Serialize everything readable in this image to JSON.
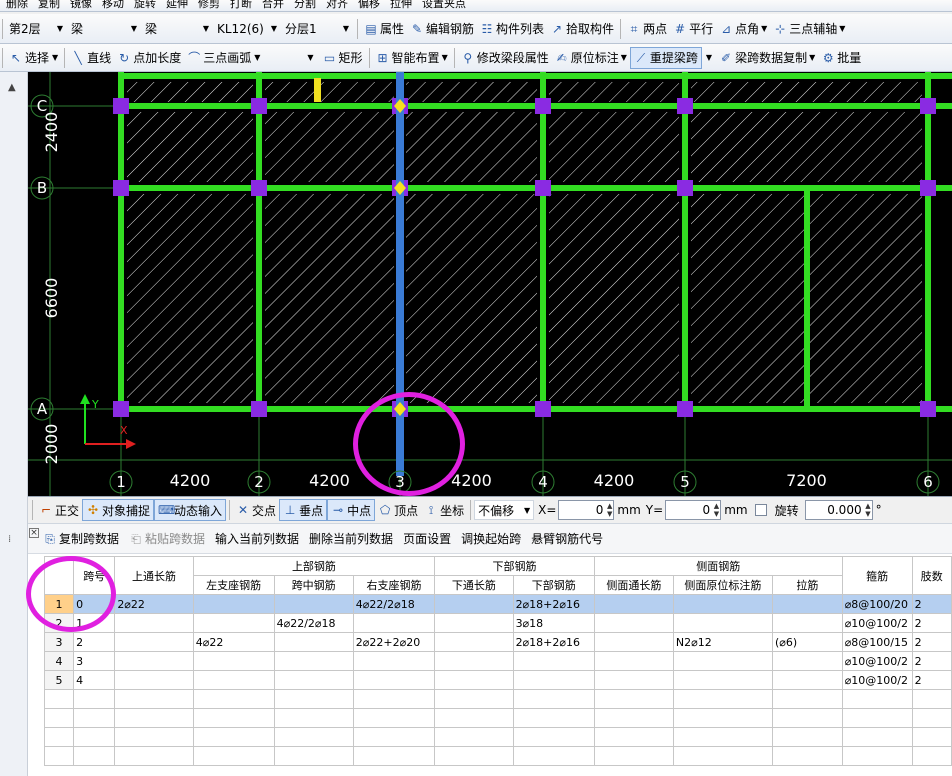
{
  "toolbar0": {
    "items": [
      "删除",
      "复制",
      "镜像",
      "移动",
      "旋转",
      "延伸",
      "修剪",
      "打断",
      "合并",
      "分割",
      "对齐",
      "偏移",
      "拉伸",
      "设置夹点"
    ]
  },
  "toolbar1": {
    "floor": "第2层",
    "type_a": "梁",
    "type_b": "梁",
    "component": "KL12(6)",
    "layer": "分层1",
    "properties": "属性",
    "edit_rebar": "编辑钢筋",
    "component_list": "构件列表",
    "pick_component": "拾取构件",
    "two_points": "两点",
    "parallel": "平行",
    "point_angle": "点角",
    "three_point_axis": "三点辅轴"
  },
  "toolbar2": {
    "select": "选择",
    "line": "直线",
    "point_length": "点加长度",
    "three_point_arc": "三点画弧",
    "rectangle": "矩形",
    "smart_layout": "智能布置",
    "modify_span_props": "修改梁段属性",
    "original_annotation": "原位标注",
    "reextract_span": "重提梁跨",
    "span_data_copy": "梁跨数据复制",
    "batch": "批量"
  },
  "canvas": {
    "colors": {
      "background": "#000000",
      "beam": "#33dd22",
      "selected_beam": "#3a7bd5",
      "column": "#8a2be2",
      "grid": "#2e7d32",
      "hatch": "#e8e8e8",
      "axis_text": "#ffffff"
    },
    "row_axes": [
      {
        "label": "C",
        "dim": "2400"
      },
      {
        "label": "B",
        "dim": "6600"
      },
      {
        "label": "A",
        "dim": "2000"
      }
    ],
    "column_axes": [
      "1",
      "2",
      "3",
      "4",
      "5",
      "6"
    ],
    "spans": [
      "4200",
      "4200",
      "4200",
      "4200",
      "7200"
    ],
    "ucs": {
      "x": "X",
      "y": "Y"
    }
  },
  "statusbar": {
    "ortho": "正交",
    "object_snap": "对象捕捉",
    "dynamic_input": "动态输入",
    "intersection": "交点",
    "perpendicular": "垂点",
    "midpoint": "中点",
    "vertex": "顶点",
    "coordinate": "坐标",
    "offset_mode": "不偏移",
    "x_label": "X=",
    "x_value": "0",
    "x_unit": "mm",
    "y_label": "Y=",
    "y_value": "0",
    "y_unit": "mm",
    "rotate_label": "旋转",
    "rotate_value": "0.000",
    "degree": "°"
  },
  "panel": {
    "toolbar": {
      "copy_span": "复制跨数据",
      "paste_span": "粘贴跨数据",
      "input_current": "输入当前列数据",
      "delete_current": "删除当前列数据",
      "page_setup": "页面设置",
      "swap_start": "调换起始跨",
      "cantilever_code": "悬臂钢筋代号"
    },
    "header": {
      "span_no": "跨号",
      "top_long": "上通长筋",
      "top_group": "上部钢筋",
      "left_support": "左支座钢筋",
      "mid_span": "跨中钢筋",
      "right_support": "右支座钢筋",
      "bottom_group": "下部钢筋",
      "bottom_long": "下通长筋",
      "bottom_bar": "下部钢筋",
      "side_group": "侧面钢筋",
      "side_long": "侧面通长筋",
      "side_original": "侧面原位标注筋",
      "tie": "拉筋",
      "stirrup": "箍筋",
      "legs": "肢数"
    },
    "rows": [
      {
        "n": "1",
        "span": "0",
        "top_long": "2⌀22",
        "left": "",
        "mid": "",
        "right": "4⌀22/2⌀18",
        "blong": "",
        "bottom": "2⌀18+2⌀16",
        "slong": "",
        "sorig": "",
        "tie": "",
        "stirrup": "⌀8@100/20",
        "legs": "2"
      },
      {
        "n": "2",
        "span": "1",
        "top_long": "",
        "left": "",
        "mid": "4⌀22/2⌀18",
        "right": "",
        "blong": "",
        "bottom": "3⌀18",
        "slong": "",
        "sorig": "",
        "tie": "",
        "stirrup": "⌀10@100/2",
        "legs": "2"
      },
      {
        "n": "3",
        "span": "2",
        "top_long": "",
        "left": "4⌀22",
        "mid": "",
        "right": "2⌀22+2⌀20",
        "blong": "",
        "bottom": "2⌀18+2⌀16",
        "slong": "",
        "sorig": "N2⌀12",
        "tie": "(⌀6)",
        "stirrup": "⌀8@100/15",
        "legs": "2"
      },
      {
        "n": "4",
        "span": "3",
        "top_long": "",
        "left": "",
        "mid": "",
        "right": "",
        "blong": "",
        "bottom": "",
        "slong": "",
        "sorig": "",
        "tie": "",
        "stirrup": "⌀10@100/2",
        "legs": "2"
      },
      {
        "n": "5",
        "span": "4",
        "top_long": "",
        "left": "",
        "mid": "",
        "right": "",
        "blong": "",
        "bottom": "",
        "slong": "",
        "sorig": "",
        "tie": "",
        "stirrup": "⌀10@100/2",
        "legs": "2"
      }
    ]
  }
}
